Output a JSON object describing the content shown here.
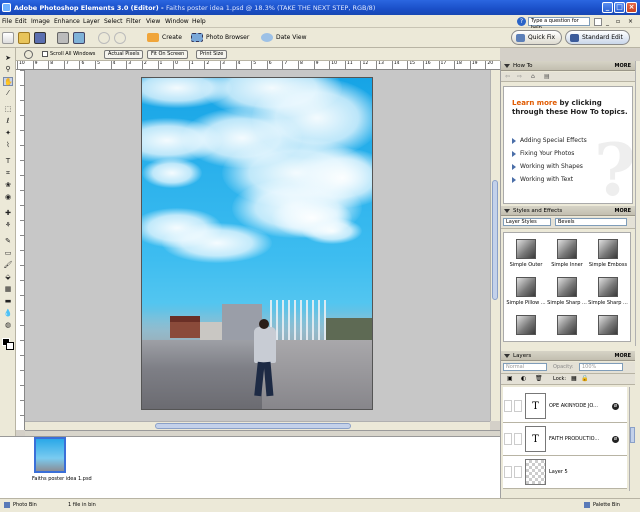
{
  "window": {
    "app_title": "Adobe Photoshop Elements 3.0 (Editor)",
    "doc_title": "Faiths poster idea 1.psd @ 18.3% (TAKE THE NEXT STEP, RGB/8)"
  },
  "menu": {
    "items": [
      "File",
      "Edit",
      "Image",
      "Enhance",
      "Layer",
      "Select",
      "Filter",
      "View",
      "Window",
      "Help"
    ],
    "help_placeholder": "Type a question for help"
  },
  "shortcuts": {
    "create_label": "Create",
    "photo_browser_label": "Photo Browser",
    "date_view_label": "Date View",
    "quick_fix_label": "Quick Fix",
    "standard_edit_label": "Standard Edit"
  },
  "options": {
    "scroll_all_label": "Scroll All Windows",
    "actual_pixels_label": "Actual Pixels",
    "fit_on_screen_label": "Fit On Screen",
    "print_size_label": "Print Size"
  },
  "ruler": {
    "top_ticks": [
      "10",
      "9",
      "8",
      "7",
      "6",
      "5",
      "4",
      "3",
      "2",
      "1",
      "0",
      "1",
      "2",
      "3",
      "4",
      "5",
      "6",
      "7",
      "8",
      "9",
      "10",
      "11",
      "12",
      "13",
      "14",
      "15",
      "16",
      "17",
      "18",
      "19",
      "20"
    ]
  },
  "howto": {
    "header": "How To",
    "more": "MORE",
    "title_highlight": "Learn more",
    "title_rest": "by clicking through these How To topics.",
    "links": [
      "Adding Special Effects",
      "Fixing Your Photos",
      "Working with Shapes",
      "Working with Text"
    ]
  },
  "styles": {
    "header": "Styles and Effects",
    "more": "MORE",
    "category": "Layer Styles",
    "subcategory": "Bevels",
    "items": [
      "Simple Outer",
      "Simple Inner",
      "Simple Emboss",
      "Simple Pillow ...",
      "Simple Sharp ...",
      "Simple Sharp ..."
    ]
  },
  "layers": {
    "header": "Layers",
    "more": "MORE",
    "blend_mode": "Normal",
    "opacity_label": "Opacity:",
    "opacity_value": "100%",
    "lock_label": "Lock:",
    "items": [
      {
        "name": "OPE AKINYODE  JO...",
        "type": "T"
      },
      {
        "name": "FAITH PRODUCTIO...",
        "type": "T"
      },
      {
        "name": "Layer 5",
        "type": ""
      }
    ]
  },
  "photobin": {
    "thumb_label": "Faiths poster idea 1.psd"
  },
  "status": {
    "photo_bin_label": "Photo Bin",
    "file_count": "1 file in bin",
    "palette_bin_label": "Palette Bin"
  }
}
